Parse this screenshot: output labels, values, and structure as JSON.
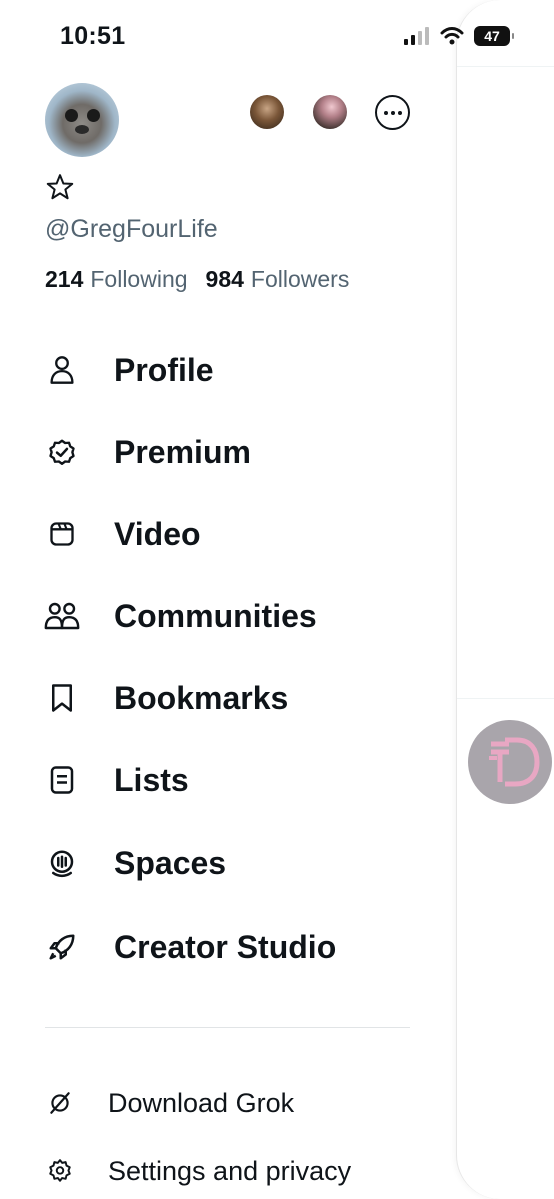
{
  "status_bar": {
    "time": "10:51",
    "battery": "47"
  },
  "profile": {
    "handle": "@GregFourLife",
    "following_count": "214",
    "following_label": "Following",
    "followers_count": "984",
    "followers_label": "Followers"
  },
  "menu": [
    {
      "label": "Profile",
      "icon": "person-icon"
    },
    {
      "label": "Premium",
      "icon": "verified-badge-icon"
    },
    {
      "label": "Video",
      "icon": "video-icon"
    },
    {
      "label": "Communities",
      "icon": "communities-icon"
    },
    {
      "label": "Bookmarks",
      "icon": "bookmark-icon"
    },
    {
      "label": "Lists",
      "icon": "list-icon"
    },
    {
      "label": "Spaces",
      "icon": "spaces-icon"
    },
    {
      "label": "Creator Studio",
      "icon": "rocket-icon"
    }
  ],
  "secondary": [
    {
      "label": "Download Grok",
      "icon": "grok-icon"
    },
    {
      "label": "Settings and privacy",
      "icon": "gear-icon"
    }
  ],
  "colors": {
    "text": "#0f1419",
    "muted": "#536471",
    "fab_bg": "#a9a5ab",
    "fab_accent": "#e8a7c3"
  }
}
